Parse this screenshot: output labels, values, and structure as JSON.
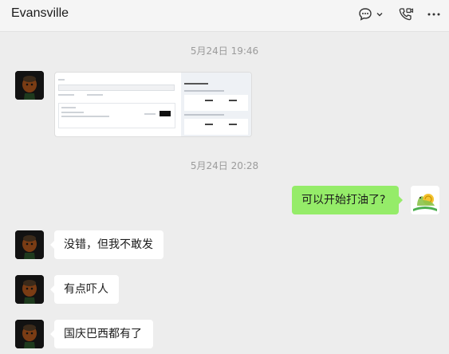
{
  "header": {
    "title": "Evansville",
    "icons": [
      "chat-bubble-icon",
      "chevron-down-icon",
      "video-call-icon",
      "more-icon"
    ]
  },
  "messages": {
    "time1": "5月24日 19:46",
    "time2": "5月24日 20:28",
    "m_right": "可以开始打油了?",
    "m_left1": "没错，但我不敢发",
    "m_left2": "有点吓人",
    "m_left3": "国庆巴西都有了"
  },
  "colors": {
    "background": "#ededed",
    "bubble_self": "#95ec69",
    "bubble_other": "#ffffff"
  }
}
